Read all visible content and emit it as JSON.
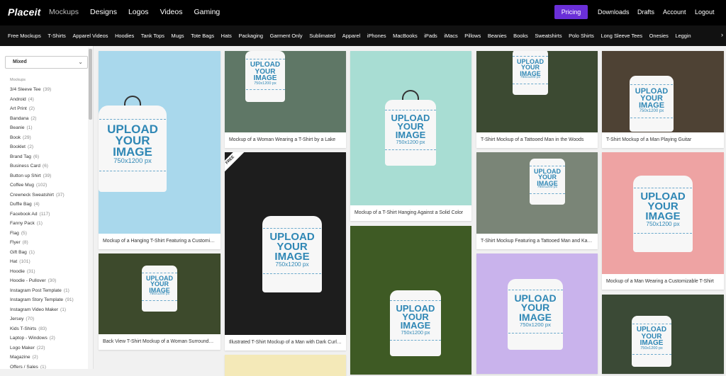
{
  "brand": {
    "name": "Placeit",
    "accent": "#6a2fd8"
  },
  "main_nav": [
    {
      "label": "Mockups",
      "active": true
    },
    {
      "label": "Designs",
      "active": false
    },
    {
      "label": "Logos",
      "active": false
    },
    {
      "label": "Videos",
      "active": false
    },
    {
      "label": "Gaming",
      "active": false
    }
  ],
  "right_nav": {
    "pricing": "Pricing",
    "downloads": "Downloads",
    "drafts": "Drafts",
    "account": "Account",
    "logout": "Logout"
  },
  "categories": [
    "Free Mockups",
    "T-Shirts",
    "Apparel Videos",
    "Hoodies",
    "Tank Tops",
    "Mugs",
    "Tote Bags",
    "Hats",
    "Packaging",
    "Garment Only",
    "Sublimated",
    "Apparel",
    "iPhones",
    "MacBooks",
    "iPads",
    "iMacs",
    "Pillows",
    "Beanies",
    "Books",
    "Sweatshirts",
    "Polo Shirts",
    "Long Sleeve Tees",
    "Onesies",
    "Leggin"
  ],
  "categories_arrow": "›",
  "sidebar": {
    "select_value": "Mixed",
    "section_heading": "Mockups",
    "items": [
      {
        "label": "3/4 Sleeve Tee",
        "count": "(39)"
      },
      {
        "label": "Android",
        "count": "(4)"
      },
      {
        "label": "Art Print",
        "count": "(2)"
      },
      {
        "label": "Bandana",
        "count": "(2)"
      },
      {
        "label": "Beanie",
        "count": "(1)"
      },
      {
        "label": "Book",
        "count": "(29)"
      },
      {
        "label": "Booklet",
        "count": "(2)"
      },
      {
        "label": "Brand Tag",
        "count": "(6)"
      },
      {
        "label": "Business Card",
        "count": "(6)"
      },
      {
        "label": "Button up Shirt",
        "count": "(39)"
      },
      {
        "label": "Coffee Mug",
        "count": "(102)"
      },
      {
        "label": "Crewneck Sweatshirt",
        "count": "(37)"
      },
      {
        "label": "Duffle Bag",
        "count": "(4)"
      },
      {
        "label": "Facebook Ad",
        "count": "(117)"
      },
      {
        "label": "Fanny Pack",
        "count": "(1)"
      },
      {
        "label": "Flag",
        "count": "(5)"
      },
      {
        "label": "Flyer",
        "count": "(8)"
      },
      {
        "label": "Gift Bag",
        "count": "(1)"
      },
      {
        "label": "Hat",
        "count": "(101)"
      },
      {
        "label": "Hoodie",
        "count": "(31)"
      },
      {
        "label": "Hoodie - Pullover",
        "count": "(30)"
      },
      {
        "label": "Instagram Post Template",
        "count": "(1)"
      },
      {
        "label": "Instagram Story Template",
        "count": "(91)"
      },
      {
        "label": "Instagram Video Maker",
        "count": "(1)"
      },
      {
        "label": "Jersey",
        "count": "(70)"
      },
      {
        "label": "Kids T-Shirts",
        "count": "(83)"
      },
      {
        "label": "Laptop - Windows",
        "count": "(2)"
      },
      {
        "label": "Logo Maker",
        "count": "(22)"
      },
      {
        "label": "Magazine",
        "count": "(2)"
      },
      {
        "label": "Offers / Sales",
        "count": "(1)"
      }
    ]
  },
  "upload": {
    "line1": "UPLOAD",
    "line2": "YOUR",
    "line3": "IMAGE",
    "size": "750x1200 px"
  },
  "free_badge": "FREE",
  "cards": [
    {
      "caption": "Mockup of a Hanging T-Shirt Featuring a Customizable Color",
      "bg": "#a9d8ec"
    },
    {
      "caption": "Back View T-Shirt Mockup of a Woman Surrounded by Plants",
      "bg": "#3d4a2c"
    },
    {
      "caption": "Mockup of a Woman Wearing a T-Shirt by a Lake",
      "bg": "#5f7766"
    },
    {
      "caption": "Illustrated T-Shirt Mockup of a Man with Dark Curly Hair",
      "bg": "#1d1d1d"
    },
    {
      "caption": "",
      "bg": "#f4e9b8"
    },
    {
      "caption": "Mockup of a T-Shirt Hanging Against a Solid Color",
      "bg": "#a8ddd3"
    },
    {
      "caption": "",
      "bg": "#3e5a24"
    },
    {
      "caption": "T-Shirt Mockup of a Tattooed Man in the Woods",
      "bg": "#3c4a32"
    },
    {
      "caption": "T-Shirt Mockup Featuring a Tattooed Man and Kayaks",
      "bg": "#7a8577"
    },
    {
      "caption": "",
      "bg": "#c9b3ec"
    },
    {
      "caption": "T-Shirt Mockup of a Man Playing Guitar",
      "bg": "#4e4234"
    },
    {
      "caption": "Mockup of a Man Wearing a Customizable T-Shirt",
      "bg": "#eea3a3"
    },
    {
      "caption": "",
      "bg": "#3b4a36"
    }
  ]
}
